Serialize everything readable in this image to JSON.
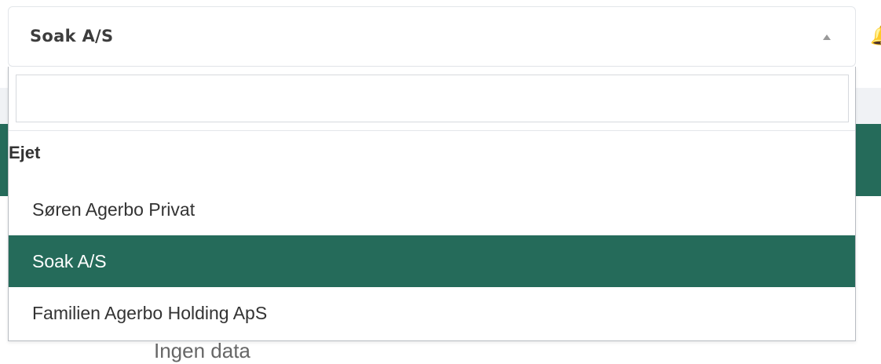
{
  "select": {
    "value": "Soak A/S",
    "search_value": ""
  },
  "dropdown": {
    "group_label": "Ejet",
    "options": [
      {
        "label": "Søren Agerbo Privat",
        "selected": false
      },
      {
        "label": "Soak A/S",
        "selected": true
      },
      {
        "label": "Familien Agerbo Holding ApS",
        "selected": false
      }
    ]
  },
  "background": {
    "empty_text": "Ingen data",
    "right_icon": "bell-icon"
  },
  "colors": {
    "accent": "#256b5a",
    "selected_text": "#ffffff",
    "border": "#e3e6ea"
  }
}
